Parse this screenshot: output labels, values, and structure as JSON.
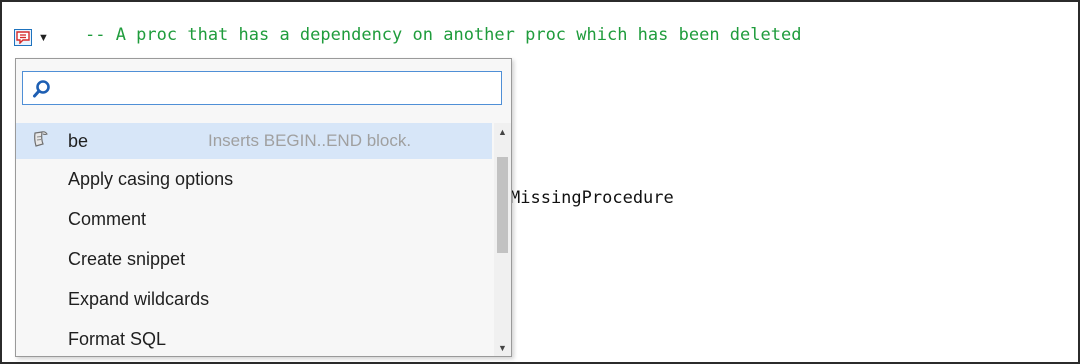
{
  "editor": {
    "comment_line": "-- A proc that has a dependency on another proc which has been deleted",
    "code_fragment": "MissingProcedure"
  },
  "action_button": {
    "icon": "comment-warning-icon",
    "dropdown_icon": "▼"
  },
  "popup": {
    "search": {
      "value": "",
      "placeholder": ""
    },
    "items": [
      {
        "label": "be",
        "description": "Inserts BEGIN..END block.",
        "icon": "snippet-icon",
        "selected": true
      },
      {
        "label": "Apply casing options"
      },
      {
        "label": "Comment"
      },
      {
        "label": "Create snippet"
      },
      {
        "label": "Expand wildcards"
      },
      {
        "label": "Format SQL"
      }
    ],
    "scrollbar": {
      "up_arrow": "▲",
      "down_arrow": "▼"
    }
  },
  "colors": {
    "comment": "#1f9c3c",
    "selection": "#d7e6f8",
    "search_border": "#4f8fd6",
    "warning_icon": "#d62b2b"
  }
}
